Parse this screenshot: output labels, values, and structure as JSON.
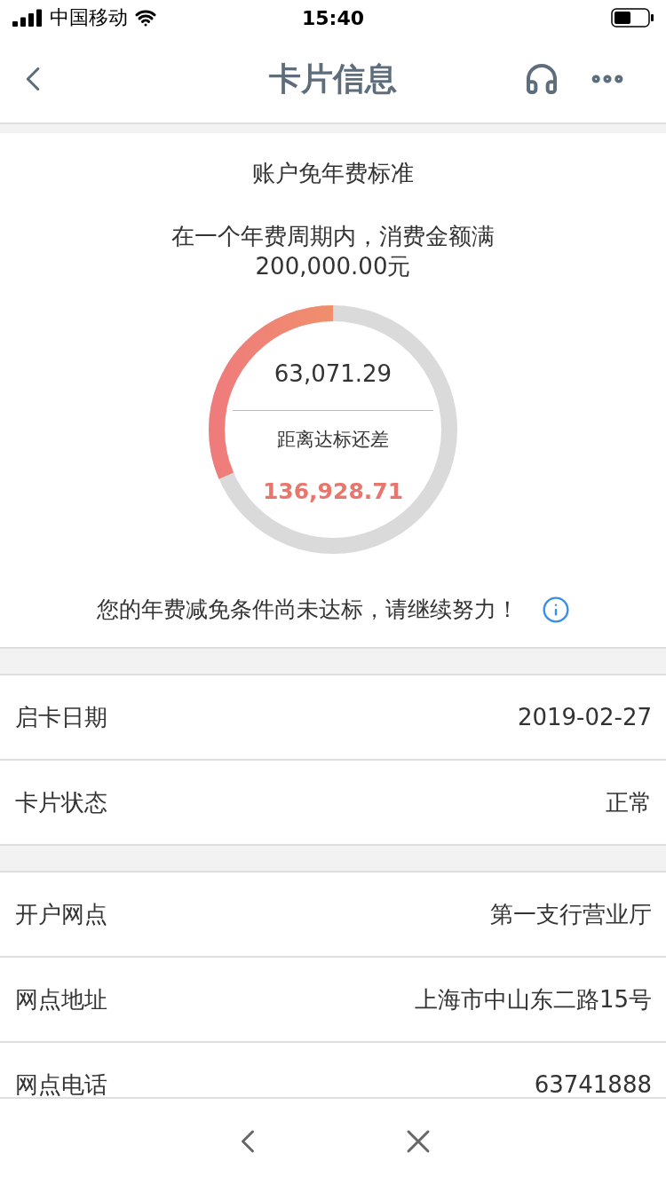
{
  "status_bar": {
    "carrier": "中国移动",
    "time": "15:40"
  },
  "nav": {
    "title": "卡片信息"
  },
  "fee_card": {
    "title": "账户免年费标准",
    "condition": "在一个年费周期内，消费金额满",
    "target": "200,000.00元",
    "spent": "63,071.29",
    "gap_label": "距离达标还差",
    "gap": "136,928.71",
    "level": 0.315,
    "notice": "您的年费减免条件尚未达标，请继续努力！"
  },
  "groups": [
    {
      "rows": [
        {
          "label": "启卡日期",
          "value": "2019-02-27"
        },
        {
          "label": "卡片状态",
          "value": "正常"
        }
      ]
    },
    {
      "rows": [
        {
          "label": "开户网点",
          "value": "第一支行营业厅"
        },
        {
          "label": "网点地址",
          "value": "上海市中山东二路15号"
        },
        {
          "label": "网点电话",
          "value": "63741888"
        }
      ]
    }
  ]
}
